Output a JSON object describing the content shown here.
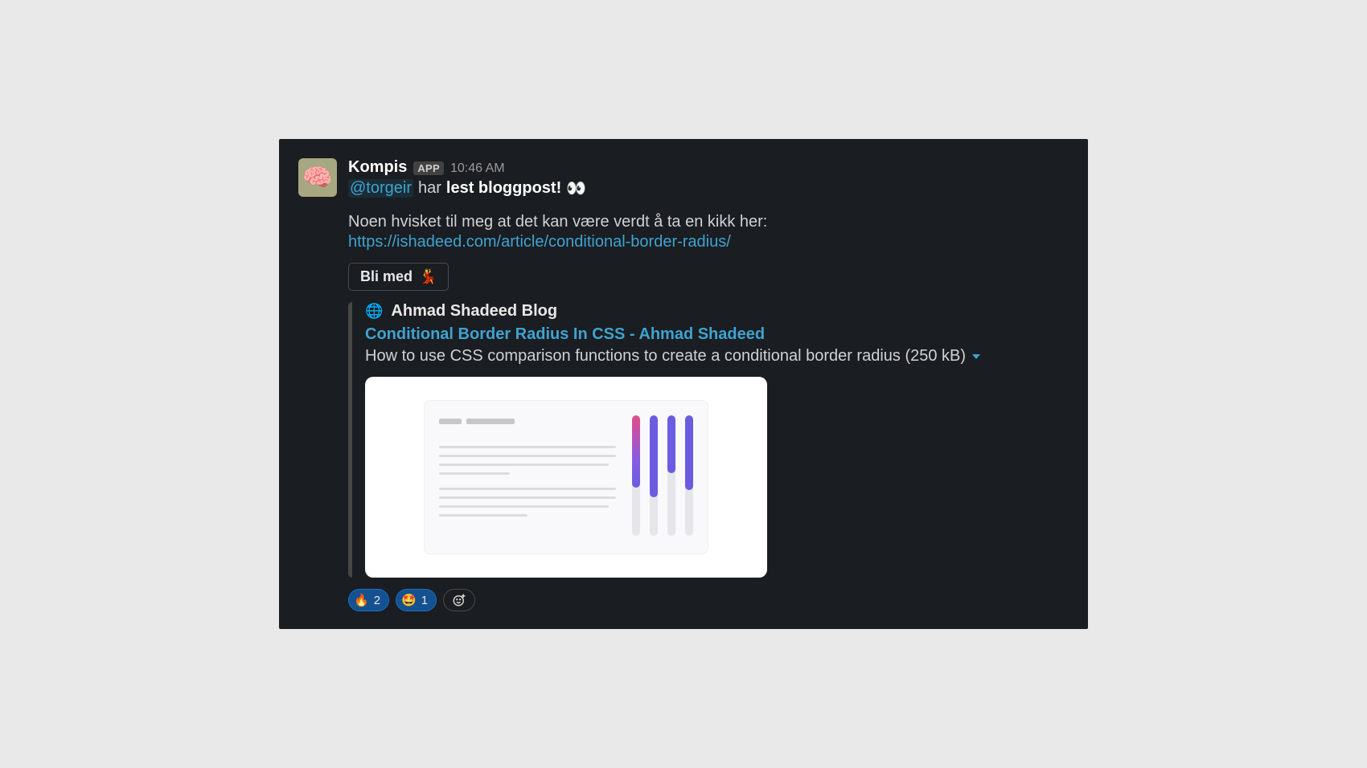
{
  "message": {
    "author": "Kompis",
    "badge": "APP",
    "timestamp": "10:46 AM",
    "subject": {
      "mention": "@torgeir",
      "middle_plain": "har",
      "bold": "lest bloggpost!",
      "emoji": "👀"
    },
    "body_text": "Noen hvisket til meg at det kan være verdt å ta en kikk her:",
    "body_link": "https://ishadeed.com/article/conditional-border-radius/",
    "action_button": {
      "label": "Bli med",
      "emoji": "💃"
    },
    "unfurl": {
      "source": "Ahmad Shadeed Blog",
      "title": "Conditional Border Radius In CSS - Ahmad Shadeed",
      "description": "How to use CSS comparison functions to create a conditional border radius (250 kB)"
    },
    "reactions": [
      {
        "emoji": "🔥",
        "count": "2"
      },
      {
        "emoji": "🤩",
        "count": "1"
      }
    ]
  }
}
